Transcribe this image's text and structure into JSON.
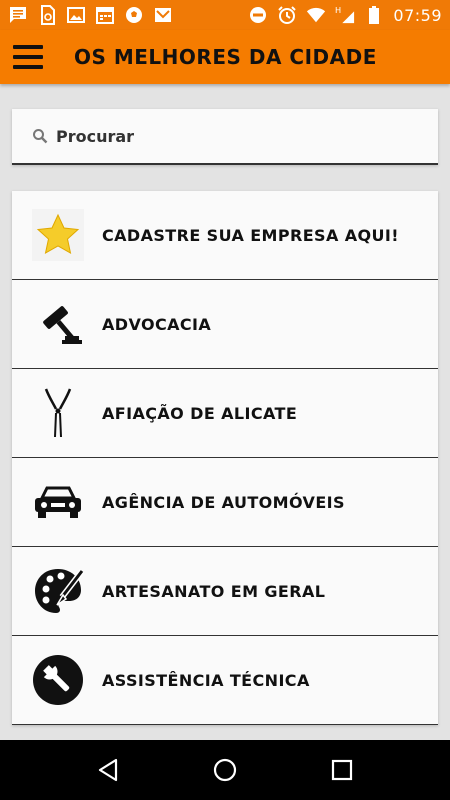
{
  "status_bar": {
    "time": "07:59",
    "icons_left": [
      "message-icon",
      "sim-icon",
      "image-icon",
      "calendar-icon",
      "soccer-ball-icon",
      "mail-icon"
    ],
    "icons_right": [
      "do-not-disturb-icon",
      "alarm-icon",
      "wifi-icon",
      "signal-h-icon",
      "battery-icon"
    ]
  },
  "app_bar": {
    "title": "OS MELHORES DA CIDADE",
    "background": "#f57c00"
  },
  "search": {
    "placeholder": "Procurar"
  },
  "categories": [
    {
      "label": "CADASTRE SUA EMPRESA AQUI!",
      "icon": "star-icon"
    },
    {
      "label": "ADVOCACIA",
      "icon": "gavel-icon"
    },
    {
      "label": "AFIAÇÃO DE ALICATE",
      "icon": "pliers-icon"
    },
    {
      "label": "AGÊNCIA DE AUTOMÓVEIS",
      "icon": "car-icon"
    },
    {
      "label": "ARTESANATO EM GERAL",
      "icon": "palette-icon"
    },
    {
      "label": "ASSISTÊNCIA TÉCNICA",
      "icon": "wrench-icon"
    }
  ],
  "nav_bar": {
    "buttons": [
      "back-icon",
      "home-icon",
      "recents-icon"
    ]
  }
}
